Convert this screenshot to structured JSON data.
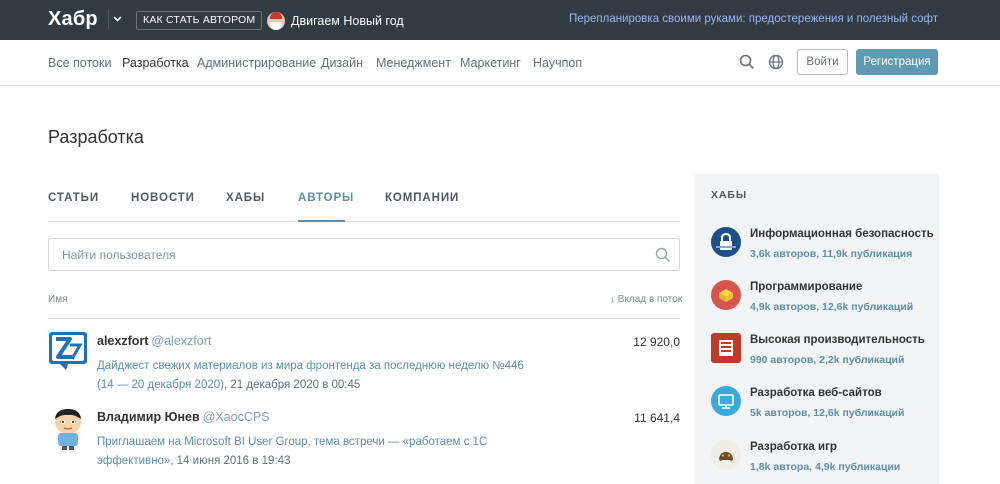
{
  "topbar": {
    "logo": "Хабр",
    "become_author": "КАК СТАТЬ АВТОРОМ",
    "promo": "Двигаем Новый год",
    "link": "Перепланировка своими руками: предостережения и полезный софт"
  },
  "nav": {
    "items": [
      "Все потоки",
      "Разработка",
      "Администрирование",
      "Дизайн",
      "Менеджмент",
      "Маркетинг",
      "Научпоп"
    ],
    "active": "Разработка",
    "login": "Войти",
    "register": "Регистрация"
  },
  "page": {
    "title": "Разработка",
    "tabs": [
      "СТАТЬИ",
      "НОВОСТИ",
      "ХАБЫ",
      "АВТОРЫ",
      "КОМПАНИИ"
    ],
    "active_tab": "АВТОРЫ"
  },
  "search": {
    "placeholder": "Найти пользователя"
  },
  "list": {
    "col_name": "Имя",
    "col_sort": "↓ Вклад в поток",
    "authors": [
      {
        "name": "alexzfort",
        "handle": "@alexzfort",
        "contribution": "12 920,0",
        "post_title": "Дайджест свежих материалов из мира фронтенда за последнюю неделю №446 (14 — 20 декабря 2020)",
        "post_date": ", 21 декабря 2020 в 00:45"
      },
      {
        "name": "Владимир Юнев",
        "handle": "@XaocCPS",
        "contribution": "11 641,4",
        "post_title": "Приглашаем на Microsoft BI User Group, тема встречи — «работаем с 1С эффективно»",
        "post_date": ", 14 июня 2016 в 19:43"
      }
    ]
  },
  "sidebar": {
    "title": "ХАБЫ",
    "hubs": [
      {
        "name": "Информационная безопасность",
        "stats": "3,6k авторов, 11,9k публикация",
        "icon": "lock-icon",
        "color": "#1d4f86"
      },
      {
        "name": "Программирование",
        "stats": "4,9k авторов, 12,6k публикаций",
        "icon": "cube-icon",
        "color": "#d9534f"
      },
      {
        "name": "Высокая производительность",
        "stats": "990 авторов, 2,2k публикаций",
        "icon": "server-icon",
        "color": "#c0392b"
      },
      {
        "name": "Разработка веб-сайтов",
        "stats": "5k авторов, 12,6k публикаций",
        "icon": "monitor-icon",
        "color": "#3aa9dc"
      },
      {
        "name": "Разработка игр",
        "stats": "1,8k автора, 4,9k публикации",
        "icon": "gamepad-icon",
        "color": "#f0ece6"
      }
    ]
  }
}
